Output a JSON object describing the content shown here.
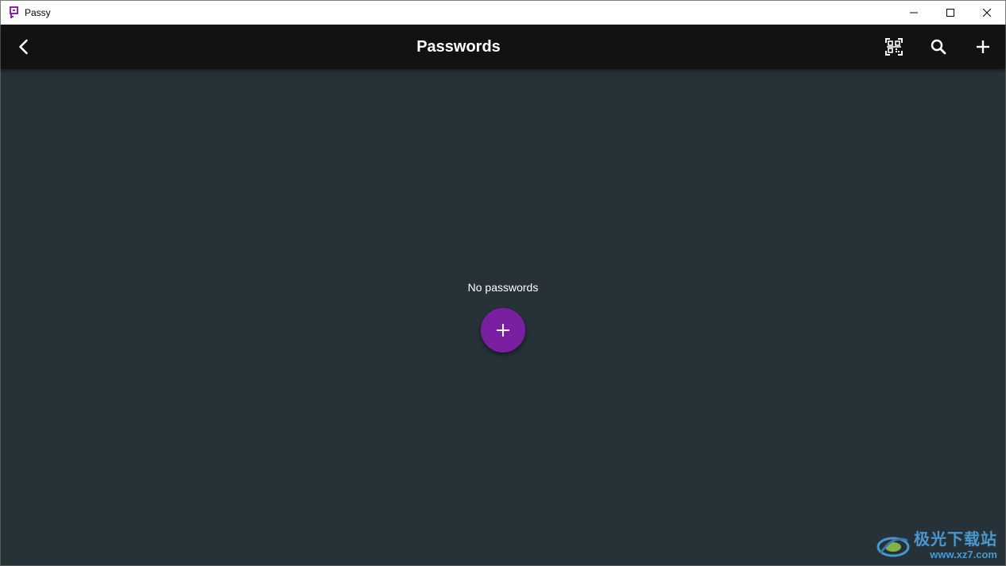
{
  "window": {
    "title": "Passy",
    "controls": [
      "minimize-icon",
      "maximize-icon",
      "close-icon"
    ]
  },
  "appbar": {
    "title": "Passwords",
    "back_icon": "chevron-left-icon",
    "actions": [
      "qr-scan-icon",
      "search-icon",
      "plus-icon"
    ]
  },
  "main": {
    "empty_message": "No passwords",
    "fab_icon": "plus-icon"
  },
  "watermark": {
    "text_cn": "极光下载站",
    "url": "www.xz7.com"
  },
  "colors": {
    "appbar_bg": "#121212",
    "content_bg": "#263238",
    "fab": "#7b1fa2",
    "app_icon": "#8e24aa"
  }
}
